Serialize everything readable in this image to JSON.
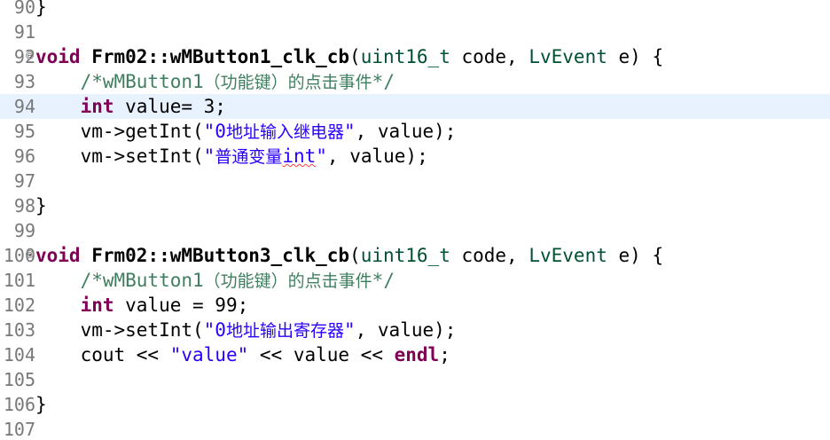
{
  "editor": {
    "highlight_color": "#e8f2fe",
    "colors": {
      "keyword": "#7f0055",
      "type": "#005032",
      "comment": "#3f7f5f",
      "string": "#2a00ff",
      "line_number": "#787878"
    },
    "lines": [
      {
        "no": "90",
        "code": {
          "t1": "}"
        }
      },
      {
        "no": "91"
      },
      {
        "no": "92",
        "fold": "⊖",
        "code": {
          "kw": "void",
          "sp": " ",
          "fn": "Frm02::wMButton1_clk_cb",
          "p1": "(",
          "ty1": "uint16_t",
          "p2": " code, ",
          "ty2": "LvEvent",
          "p3": " e) {"
        }
      },
      {
        "no": "93",
        "code": {
          "ind": "    ",
          "c1": "/*wMButton1",
          "c2": "（功能键）的点击事件",
          "c3": "*/"
        }
      },
      {
        "no": "94",
        "code": {
          "ind": "    ",
          "kw": "int",
          "t1": " value= 3;"
        }
      },
      {
        "no": "95",
        "code": {
          "ind": "    ",
          "t1": "vm->getInt(",
          "s1": "\"0",
          "s2": "地址输入继电器",
          "s3": "\"",
          "t2": ", value);"
        }
      },
      {
        "no": "96",
        "code": {
          "ind": "    ",
          "t1": "vm->setInt(",
          "s1": "\"",
          "s2": "普通变量",
          "s3": "int",
          "s4": "\"",
          "t2": ", value);"
        }
      },
      {
        "no": "97"
      },
      {
        "no": "98",
        "code": {
          "t1": "}"
        }
      },
      {
        "no": "99"
      },
      {
        "no": "100",
        "fold": "⊖",
        "code": {
          "kw": "void",
          "sp": " ",
          "fn": "Frm02::wMButton3_clk_cb",
          "p1": "(",
          "ty1": "uint16_t",
          "p2": " code, ",
          "ty2": "LvEvent",
          "p3": " e) {"
        }
      },
      {
        "no": "101",
        "code": {
          "ind": "    ",
          "c1": "/*wMButton1",
          "c2": "（功能键）的点击事件",
          "c3": "*/"
        }
      },
      {
        "no": "102",
        "code": {
          "ind": "    ",
          "kw": "int",
          "t1": " value = 99;"
        }
      },
      {
        "no": "103",
        "code": {
          "ind": "    ",
          "t1": "vm->setInt(",
          "s1": "\"0",
          "s2": "地址输出寄存器",
          "s3": "\"",
          "t2": ", value);"
        }
      },
      {
        "no": "104",
        "code": {
          "ind": "    ",
          "t1": "cout << ",
          "s1": "\"value\"",
          "t2": " << value << ",
          "kw": "endl",
          "t3": ";"
        }
      },
      {
        "no": "105"
      },
      {
        "no": "106",
        "code": {
          "t1": "}"
        }
      },
      {
        "no": "107"
      }
    ]
  }
}
